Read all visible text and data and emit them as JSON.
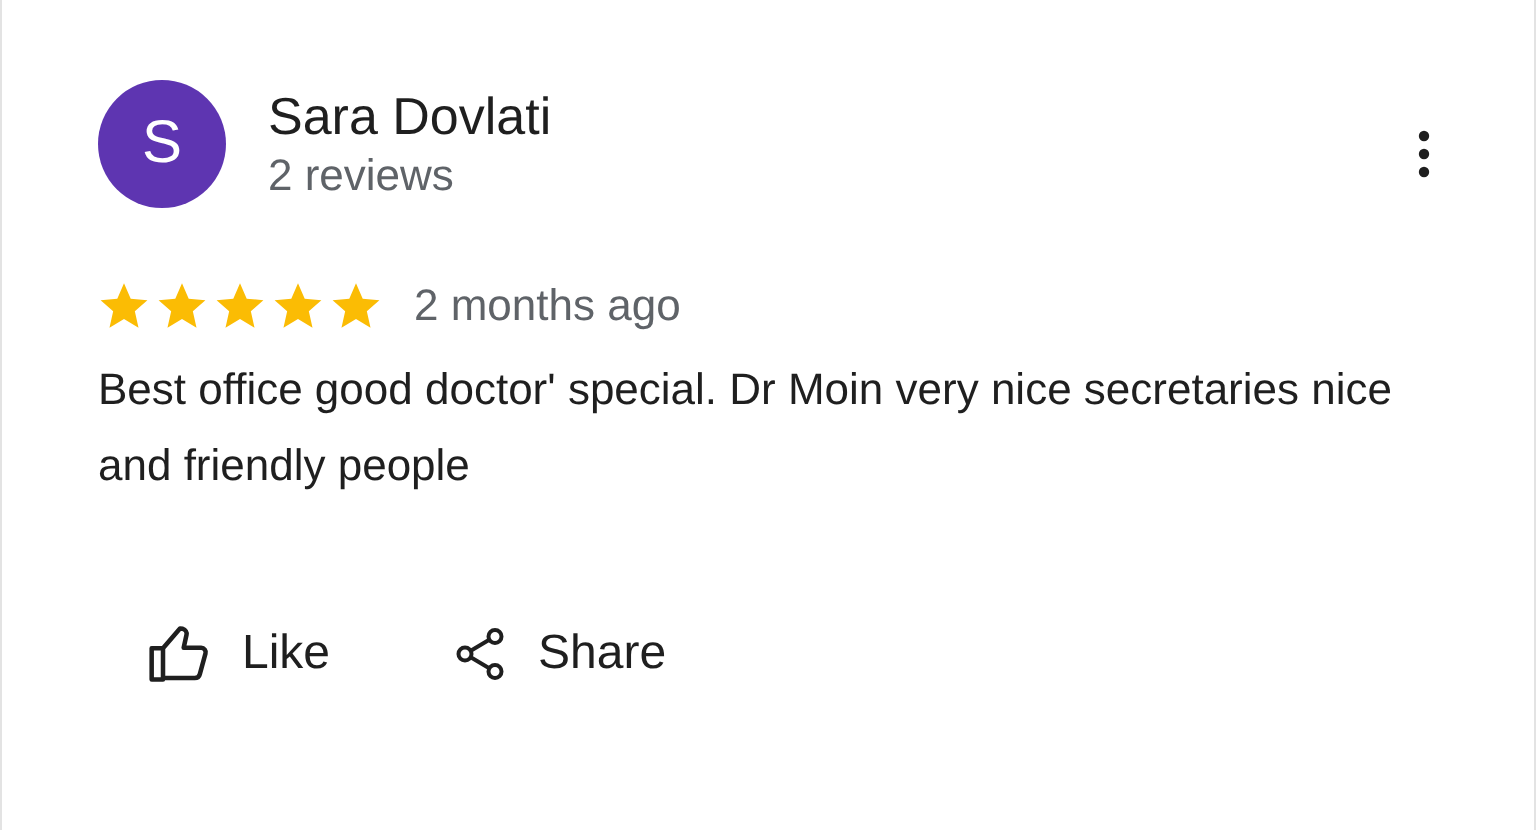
{
  "reviewer": {
    "avatar_letter": "S",
    "name": "Sara Dovlati",
    "review_count": "2 reviews"
  },
  "review": {
    "stars": 5,
    "time": "2 months ago",
    "text": "Best office good doctor' special. Dr Moin very nice secretaries nice and friendly people"
  },
  "actions": [
    {
      "kind": "like",
      "label": "Like"
    },
    {
      "kind": "share",
      "label": "Share"
    }
  ]
}
